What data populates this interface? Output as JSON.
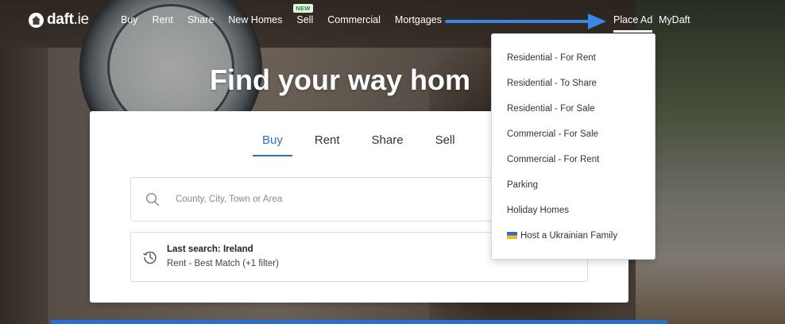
{
  "brand": {
    "name": "daft",
    "suffix": ".ie"
  },
  "nav": {
    "items": [
      {
        "label": "Buy"
      },
      {
        "label": "Rent"
      },
      {
        "label": "Share"
      },
      {
        "label": "New Homes"
      },
      {
        "label": "Sell",
        "badge": "NEW"
      },
      {
        "label": "Commercial"
      },
      {
        "label": "Mortgages"
      }
    ],
    "place_ad": "Place Ad",
    "mydaft": "MyDaft"
  },
  "hero": {
    "title": "Find your way hom"
  },
  "search": {
    "tabs": [
      {
        "label": "Buy",
        "active": true
      },
      {
        "label": "Rent"
      },
      {
        "label": "Share"
      },
      {
        "label": "Sell"
      }
    ],
    "placeholder": "County, City, Town or Area",
    "last_search": {
      "title": "Last search: Ireland",
      "subtitle": "Rent - Best Match (+1 filter)"
    }
  },
  "place_ad_menu": {
    "items": [
      {
        "label": "Residential - For Rent"
      },
      {
        "label": "Residential - To Share"
      },
      {
        "label": "Residential - For Sale"
      },
      {
        "label": "Commercial - For Sale"
      },
      {
        "label": "Commercial - For Rent"
      },
      {
        "label": "Parking"
      },
      {
        "label": "Holiday Homes"
      },
      {
        "label": "Host a Ukrainian Family",
        "icon": "ukraine-flag-icon"
      }
    ]
  },
  "colors": {
    "accent": "#2d6ec9",
    "arrow": "#3a86e8",
    "badge_bg": "#e3f5e1",
    "badge_text": "#1f8a3b"
  }
}
